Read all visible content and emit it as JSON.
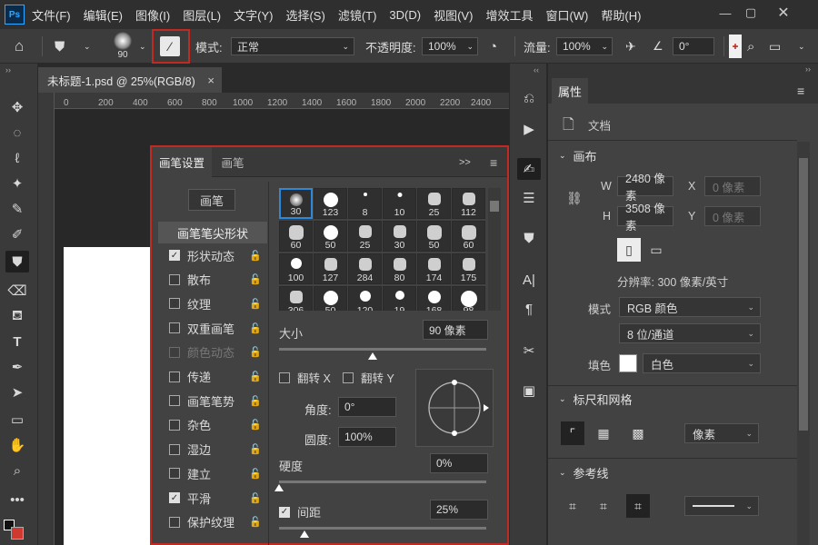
{
  "menu": {
    "logo": "Ps",
    "items": [
      "文件(F)",
      "编辑(E)",
      "图像(I)",
      "图层(L)",
      "文字(Y)",
      "选择(S)",
      "滤镜(T)",
      "3D(D)",
      "视图(V)",
      "增效工具",
      "窗口(W)",
      "帮助(H)"
    ]
  },
  "options": {
    "brush_size": "90",
    "mode_label": "模式:",
    "mode_value": "正常",
    "opacity_label": "不透明度:",
    "opacity_value": "100%",
    "flow_label": "流量:",
    "flow_value": "100%",
    "angle_value": "0°"
  },
  "document_tab": {
    "title": "未标题-1.psd @ 25%(RGB/8)",
    "close": "×"
  },
  "ruler": {
    "ticks": [
      "0",
      "200",
      "400",
      "600",
      "800",
      "1000",
      "1200",
      "1400",
      "1600",
      "1800",
      "2000",
      "2200",
      "2400"
    ]
  },
  "brush_panel": {
    "tab_settings": "画笔设置",
    "tab_brushes": "画笔",
    "brush_button": "画笔",
    "tip_shape": "画笔笔尖形状",
    "options": [
      {
        "label": "形状动态",
        "checked": true,
        "disabled": false
      },
      {
        "label": "散布",
        "checked": false,
        "disabled": false
      },
      {
        "label": "纹理",
        "checked": false,
        "disabled": false
      },
      {
        "label": "双重画笔",
        "checked": false,
        "disabled": false
      },
      {
        "label": "颜色动态",
        "checked": false,
        "disabled": true
      },
      {
        "label": "传递",
        "checked": false,
        "disabled": false
      },
      {
        "label": "画笔笔势",
        "checked": false,
        "disabled": false
      },
      {
        "label": "杂色",
        "checked": false,
        "disabled": false
      },
      {
        "label": "湿边",
        "checked": false,
        "disabled": false
      },
      {
        "label": "建立",
        "checked": false,
        "disabled": false
      },
      {
        "label": "平滑",
        "checked": true,
        "disabled": false
      },
      {
        "label": "保护纹理",
        "checked": false,
        "disabled": false
      }
    ],
    "presets": [
      "30",
      "123",
      "8",
      "10",
      "25",
      "112",
      "60",
      "50",
      "25",
      "30",
      "50",
      "60",
      "100",
      "127",
      "284",
      "80",
      "174",
      "175",
      "306",
      "50",
      "120",
      "19",
      "168",
      "98"
    ],
    "size_label": "大小",
    "size_value": "90 像素",
    "flip_x": "翻转 X",
    "flip_y": "翻转 Y",
    "angle_label": "角度:",
    "angle_value": "0°",
    "roundness_label": "圆度:",
    "roundness_value": "100%",
    "hardness_label": "硬度",
    "hardness_value": "0%",
    "spacing_label": "间距",
    "spacing_value": "25%",
    "size_fraction": 0.45,
    "hardness_fraction": 0.0
  },
  "properties": {
    "tab": "属性",
    "doc_label": "文档",
    "canvas_title": "画布",
    "w_label": "W",
    "w_value": "2480 像素",
    "x_label": "X",
    "x_placeholder": "0 像素",
    "h_label": "H",
    "h_value": "3508 像素",
    "y_label": "Y",
    "y_placeholder": "0 像素",
    "resolution": "分辨率: 300 像素/英寸",
    "mode_label": "模式",
    "mode_value": "RGB 颜色",
    "depth_value": "8 位/通道",
    "fill_label": "填色",
    "fill_value": "白色",
    "rulers_title": "标尺和网格",
    "unit_value": "像素",
    "guides_title": "参考线"
  },
  "colors": {
    "accent_red": "#c12a22",
    "selection_blue": "#2d88d9"
  }
}
